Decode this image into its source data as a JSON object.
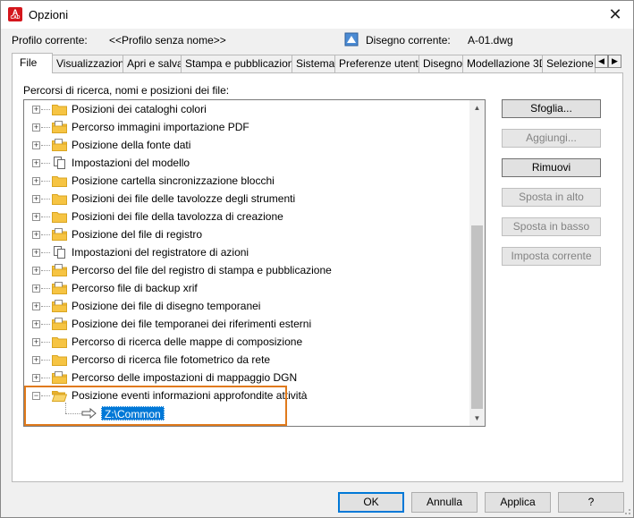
{
  "window": {
    "title": "Opzioni",
    "close_glyph": "✕",
    "app_icon_letter": "A",
    "app_icon_caption": "CAD"
  },
  "profile": {
    "current_profile_label": "Profilo corrente:",
    "current_profile_value": "<<Profilo senza nome>>",
    "current_drawing_label": "Disegno corrente:",
    "current_drawing_value": "A-01.dwg"
  },
  "tabs": [
    {
      "label": "File",
      "active": true
    },
    {
      "label": "Visualizzazione"
    },
    {
      "label": "Apri e salva"
    },
    {
      "label": "Stampa e pubblicazione"
    },
    {
      "label": "Sistema"
    },
    {
      "label": "Preferenze utente"
    },
    {
      "label": "Disegno"
    },
    {
      "label": "Modellazione 3D"
    },
    {
      "label": "Selezione"
    }
  ],
  "tab_scroll": {
    "left": "◀",
    "right": "▶"
  },
  "file_panel": {
    "label": "Percorsi di ricerca, nomi e posizioni dei file:",
    "tree_items": [
      {
        "label": "Posizioni dei cataloghi colori",
        "icon": "folder-icon"
      },
      {
        "label": "Percorso immagini importazione PDF",
        "icon": "folder-file-icon"
      },
      {
        "label": "Posizione della fonte dati",
        "icon": "folder-file-icon"
      },
      {
        "label": "Impostazioni del modello",
        "icon": "documents-icon"
      },
      {
        "label": "Posizione cartella sincronizzazione blocchi",
        "icon": "folder-icon"
      },
      {
        "label": "Posizioni dei file delle tavolozze degli strumenti",
        "icon": "folder-icon"
      },
      {
        "label": "Posizioni dei file della tavolozza di creazione",
        "icon": "folder-icon"
      },
      {
        "label": "Posizione del file di registro",
        "icon": "folder-file-icon"
      },
      {
        "label": "Impostazioni del registratore di azioni",
        "icon": "documents-icon"
      },
      {
        "label": "Percorso del file del registro di stampa e pubblicazione",
        "icon": "folder-file-icon"
      },
      {
        "label": "Percorso file di backup xrif",
        "icon": "folder-file-icon"
      },
      {
        "label": "Posizione dei file di disegno temporanei",
        "icon": "folder-file-icon"
      },
      {
        "label": "Posizione dei file temporanei dei riferimenti esterni",
        "icon": "folder-file-icon"
      },
      {
        "label": "Percorso di ricerca delle mappe di composizione",
        "icon": "folder-icon"
      },
      {
        "label": "Percorso di ricerca file fotometrico da rete",
        "icon": "folder-icon"
      },
      {
        "label": "Percorso delle impostazioni di mappaggio DGN",
        "icon": "folder-file-icon"
      },
      {
        "label": "Posizione eventi informazioni approfondite attività",
        "icon": "folder-open-icon",
        "expanded": true
      }
    ],
    "expanded_child": {
      "label": "Z:\\Common"
    },
    "expander_collapsed": "+",
    "expander_expanded": "−"
  },
  "side_buttons": [
    {
      "label": "Sfoglia...",
      "enabled": true
    },
    {
      "label": "Aggiungi...",
      "enabled": false
    },
    {
      "label": "Rimuovi",
      "enabled": true
    },
    {
      "label": "Sposta in alto",
      "enabled": false
    },
    {
      "label": "Sposta in basso",
      "enabled": false
    },
    {
      "label": "Imposta corrente",
      "enabled": false
    }
  ],
  "footer_buttons": {
    "ok": "OK",
    "cancel": "Annulla",
    "apply": "Applica",
    "help": "?"
  },
  "colors": {
    "selection": "#0078d7",
    "highlight_box": "#e07a1c",
    "folder": "#f6c443"
  }
}
